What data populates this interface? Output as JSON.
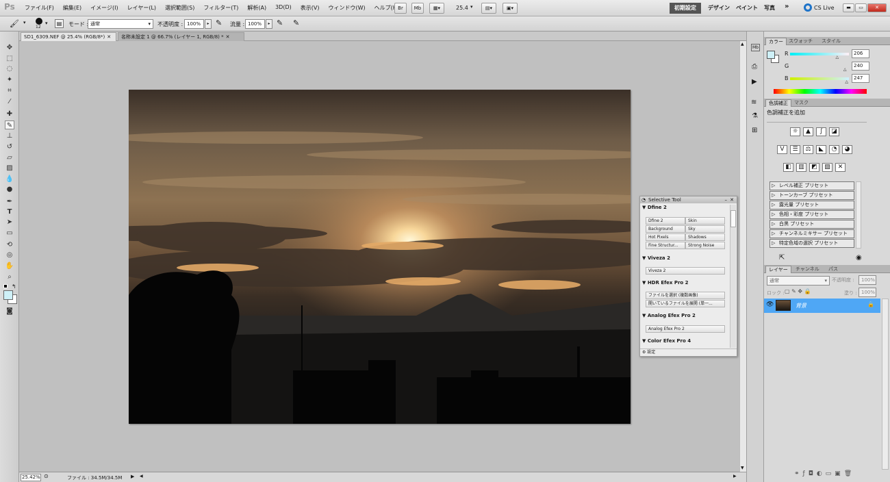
{
  "app": {
    "logo": "Ps"
  },
  "menu": [
    "ファイル(F)",
    "編集(E)",
    "イメージ(I)",
    "レイヤー(L)",
    "選択範囲(S)",
    "フィルター(T)",
    "解析(A)",
    "3D(D)",
    "表示(V)",
    "ウィンドウ(W)",
    "ヘルプ(H)"
  ],
  "appbar": {
    "br": "Br",
    "mb": "Mb",
    "zoom": "25.4",
    "cs_live": "CS Live"
  },
  "workspaces": {
    "active": "初期設定",
    "items": [
      "デザイン",
      "ペイント",
      "写真"
    ],
    "more": "»"
  },
  "options": {
    "brush_size": "12",
    "mode_label": "モード :",
    "mode_value": "通常",
    "opacity_label": "不透明度 :",
    "opacity_value": "100%",
    "flow_label": "流量 :",
    "flow_value": "100%"
  },
  "tabs": [
    {
      "label": "SD1_6309.NEF @ 25.4% (RGB/8*)"
    },
    {
      "label": "名称未設定 1 @ 66.7% (レイヤー 1, RGB/8) *"
    }
  ],
  "status": {
    "zoom": "25.42%",
    "file": "ファイル : 34.5M/34.5M"
  },
  "selective": {
    "title": "Selective Tool",
    "dfine": {
      "heading": "Dfine 2",
      "buttons": [
        "Dfine 2",
        "Skin",
        "Background",
        "Sky",
        "Hot Pixels",
        "Shadows",
        "Fine Structur...",
        "Strong Noise"
      ]
    },
    "viveza": {
      "heading": "Viveza 2",
      "button": "Viveza 2"
    },
    "hdr": {
      "heading": "HDR Efex Pro 2",
      "buttons": [
        "ファイルを選択 (複数画像)",
        "開いているファイルを展開 (単一..."
      ]
    },
    "analog": {
      "heading": "Analog Efex Pro 2",
      "button": "Analog Efex Pro 2"
    },
    "color": {
      "heading": "Color Efex Pro 4"
    },
    "settings": "設定"
  },
  "color_panel": {
    "tabs": [
      "カラー",
      "スウォッチ",
      "スタイル"
    ],
    "r_label": "R",
    "g_label": "G",
    "b_label": "B",
    "r": "206",
    "g": "240",
    "b": "247",
    "r_frac": 0.808,
    "g_frac": 0.941,
    "b_frac": 0.969,
    "fg": "#cef0f7"
  },
  "adjust_panel": {
    "tabs": [
      "色調補正",
      "マスク"
    ],
    "subtitle": "色調補正を追加",
    "presets": [
      "レベル補正 プリセット",
      "トーンカーブ プリセット",
      "露光量 プリセット",
      "色相・彩度 プリセット",
      "白黒 プリセット",
      "チャンネルミキサー プリセット",
      "特定色域の選択 プリセット"
    ]
  },
  "layers_panel": {
    "tabs": [
      "レイヤー",
      "チャンネル",
      "パス"
    ],
    "blend": "通常",
    "opacity_label": "不透明度 :",
    "opacity_value": "100%",
    "lock_label": "ロック :",
    "fill_label": "塗り :",
    "fill_value": "100%",
    "layer_name": "背景"
  },
  "colors": {
    "accent": "#3d9ff0",
    "selected_layer": "#4fa7f5"
  }
}
